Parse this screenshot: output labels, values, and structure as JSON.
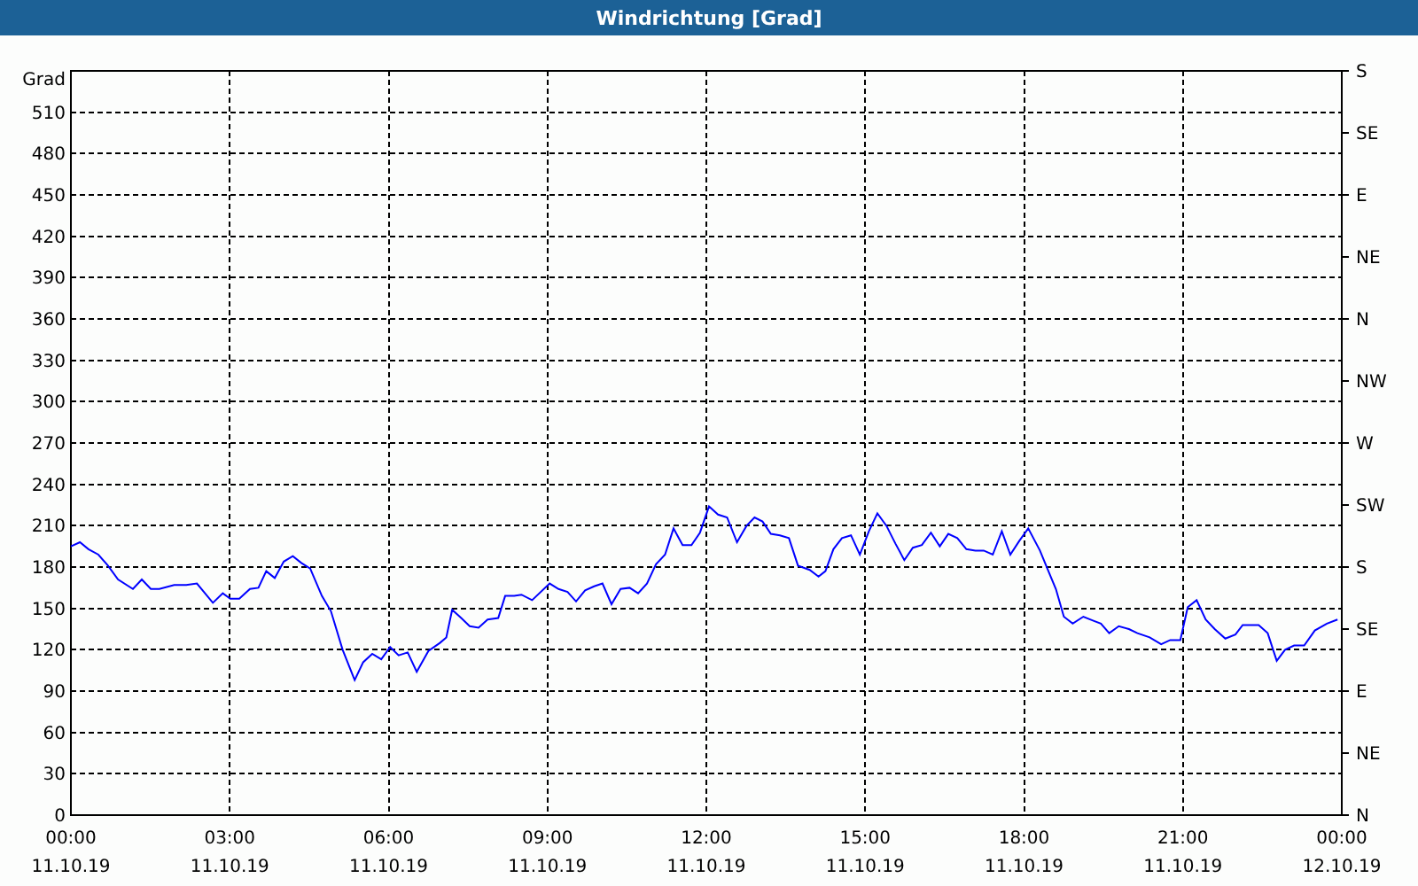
{
  "window": {
    "title": "Windrichtung [Grad]"
  },
  "chart": {
    "x_dates": [
      "11.10.19",
      "11.10.19",
      "11.10.19",
      "11.10.19",
      "11.10.19",
      "11.10.19",
      "11.10.19",
      "11.10.19",
      "12.10.19"
    ],
    "compass_labels": [
      "S",
      "SE",
      "E",
      "NE",
      "N",
      "NW",
      "W",
      "SW",
      "S",
      "SE",
      "E",
      "NE",
      "N"
    ],
    "chart_data": {
      "type": "line",
      "grid": true,
      "ylabel": "Grad",
      "xlim": [
        0,
        24
      ],
      "ylim": [
        0,
        540
      ],
      "yticks": [
        0,
        30,
        60,
        90,
        120,
        150,
        180,
        210,
        240,
        270,
        300,
        330,
        360,
        390,
        420,
        450,
        480,
        510
      ],
      "xticks": [
        {
          "value": 0,
          "label": "00:00"
        },
        {
          "value": 3,
          "label": "03:00"
        },
        {
          "value": 6,
          "label": "06:00"
        },
        {
          "value": 9,
          "label": "09:00"
        },
        {
          "value": 12,
          "label": "12:00"
        },
        {
          "value": 15,
          "label": "15:00"
        },
        {
          "value": 18,
          "label": "18:00"
        },
        {
          "value": 21,
          "label": "21:00"
        },
        {
          "value": 24,
          "label": "00:00"
        }
      ],
      "x": [
        0,
        0.17,
        0.33,
        0.52,
        0.7,
        0.89,
        1.17,
        1.34,
        1.51,
        1.67,
        1.95,
        2.18,
        2.38,
        2.68,
        2.87,
        3.01,
        3.18,
        3.38,
        3.54,
        3.69,
        3.85,
        4.02,
        4.19,
        4.35,
        4.52,
        4.74,
        4.91,
        5.13,
        5.36,
        5.52,
        5.69,
        5.86,
        6.03,
        6.19,
        6.36,
        6.53,
        6.75,
        6.97,
        7.09,
        7.2,
        7.37,
        7.53,
        7.7,
        7.87,
        8.07,
        8.2,
        8.37,
        8.51,
        8.71,
        9.04,
        9.21,
        9.38,
        9.54,
        9.71,
        9.88,
        10.04,
        10.21,
        10.38,
        10.55,
        10.71,
        10.88,
        11.05,
        11.22,
        11.38,
        11.55,
        11.72,
        11.88,
        12.05,
        12.22,
        12.39,
        12.58,
        12.76,
        12.91,
        13.06,
        13.22,
        13.39,
        13.56,
        13.73,
        13.95,
        14.12,
        14.25,
        14.4,
        14.56,
        14.73,
        14.9,
        15.07,
        15.23,
        15.4,
        15.57,
        15.74,
        15.9,
        16.07,
        16.24,
        16.41,
        16.57,
        16.74,
        16.91,
        17.08,
        17.24,
        17.41,
        17.58,
        17.74,
        17.91,
        18.08,
        18.3,
        18.47,
        18.6,
        18.75,
        18.92,
        19.12,
        19.31,
        19.45,
        19.61,
        19.79,
        19.98,
        20.14,
        20.37,
        20.59,
        20.76,
        20.95,
        21.09,
        21.26,
        21.43,
        21.6,
        21.8,
        21.99,
        22.13,
        22.43,
        22.6,
        22.77,
        22.93,
        23.1,
        23.29,
        23.49,
        23.72,
        23.92
      ],
      "series": [
        {
          "color": "#0000ff",
          "values": [
            195,
            198,
            193,
            189,
            181,
            171,
            164,
            171,
            164,
            164,
            167,
            167,
            168,
            154,
            161,
            157,
            157,
            164,
            165,
            177,
            172,
            184,
            188,
            183,
            179,
            159,
            148,
            120,
            98,
            111,
            117,
            113,
            122,
            116,
            118,
            104,
            119,
            125,
            129,
            149,
            143,
            137,
            136,
            142,
            143,
            159,
            159,
            160,
            156,
            168,
            164,
            162,
            155,
            163,
            166,
            168,
            153,
            164,
            165,
            161,
            168,
            182,
            189,
            208,
            196,
            196,
            205,
            224,
            218,
            216,
            198,
            210,
            216,
            213,
            204,
            203,
            201,
            181,
            178,
            173,
            177,
            193,
            201,
            203,
            189,
            206,
            219,
            210,
            197,
            185,
            194,
            196,
            205,
            195,
            204,
            201,
            193,
            192,
            192,
            189,
            206,
            189,
            199,
            208,
            192,
            176,
            164,
            144,
            139,
            144,
            141,
            139,
            132,
            137,
            135,
            132,
            129,
            124,
            127,
            127,
            151,
            156,
            142,
            135,
            128,
            131,
            138,
            138,
            132,
            112,
            120,
            123,
            123,
            134,
            139,
            142
          ]
        }
      ]
    }
  }
}
